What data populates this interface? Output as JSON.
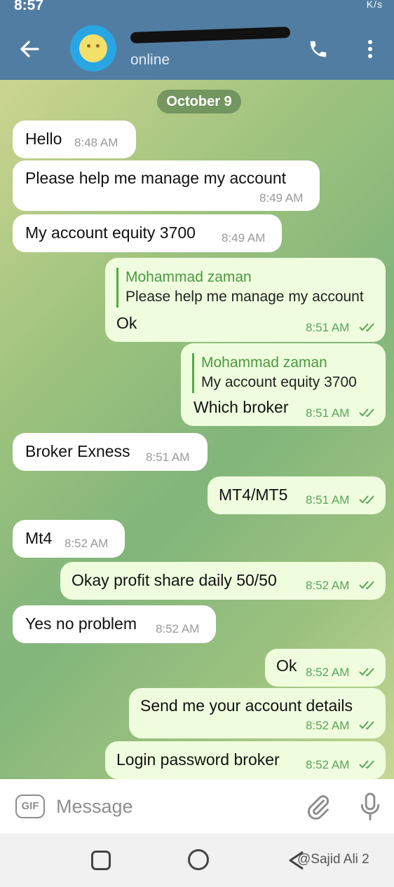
{
  "status_bar": {
    "time": "8:57",
    "right": "K/s"
  },
  "header": {
    "status": "online",
    "icons": [
      "back-arrow-icon",
      "avatar",
      "phone-icon",
      "more-vertical-icon"
    ]
  },
  "date_chip": "October 9",
  "messages": [
    {
      "text": "Hello",
      "time": "8:48 AM"
    },
    {
      "text": "Please help me manage my account",
      "time": "8:49 AM"
    },
    {
      "text": "My account equity 3700",
      "time": "8:49 AM"
    },
    {
      "reply_name": "Mohammad zaman",
      "reply_text": "Please help me manage my account",
      "text": "Ok",
      "time": "8:51 AM"
    },
    {
      "reply_name": "Mohammad zaman",
      "reply_text": "My account equity 3700",
      "text": "Which broker",
      "time": "8:51 AM"
    },
    {
      "text": "Broker Exness",
      "time": "8:51 AM"
    },
    {
      "text": "MT4/MT5",
      "time": "8:51 AM"
    },
    {
      "text": "Mt4",
      "time": "8:52 AM"
    },
    {
      "text": "Okay profit share daily 50/50",
      "time": "8:52 AM"
    },
    {
      "text": "Yes no problem",
      "time": "8:52 AM"
    },
    {
      "text": "Ok",
      "time": "8:52 AM"
    },
    {
      "text": "Send me your account details",
      "time": "8:52 AM"
    },
    {
      "text": "Login password broker",
      "time": "8:52 AM"
    }
  ],
  "input": {
    "gif_label": "GIF",
    "placeholder": "Message"
  },
  "watermark": "@Sajid Ali 2",
  "colors": {
    "header": "#517da2",
    "incoming": "#ffffff",
    "outgoing": "#effdde",
    "reply_accent": "#4a9a3f"
  }
}
